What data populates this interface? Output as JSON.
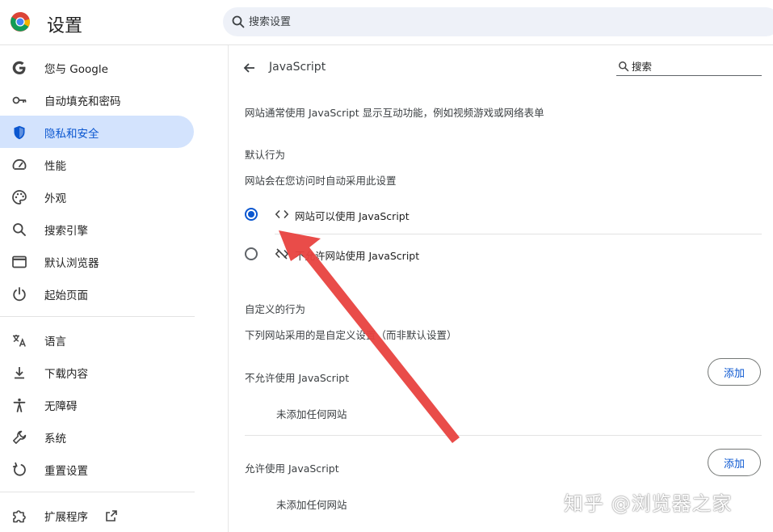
{
  "header": {
    "app_title": "设置",
    "search_placeholder": "搜索设置",
    "logo_icon": "chrome-logo-icon",
    "search_icon": "search-icon"
  },
  "sidebar": {
    "items": [
      {
        "label": "您与 Google",
        "icon": "google-g-icon",
        "active": false
      },
      {
        "label": "自动填充和密码",
        "icon": "key-icon",
        "active": false
      },
      {
        "label": "隐私和安全",
        "icon": "shield-icon",
        "active": true
      },
      {
        "label": "性能",
        "icon": "speedometer-icon",
        "active": false
      },
      {
        "label": "外观",
        "icon": "palette-icon",
        "active": false
      },
      {
        "label": "搜索引擎",
        "icon": "search-icon",
        "active": false
      },
      {
        "label": "默认浏览器",
        "icon": "browser-window-icon",
        "active": false
      },
      {
        "label": "起始页面",
        "icon": "power-icon",
        "active": false
      },
      {
        "label": "语言",
        "icon": "translate-icon",
        "active": false
      },
      {
        "label": "下载内容",
        "icon": "download-icon",
        "active": false
      },
      {
        "label": "无障碍",
        "icon": "accessibility-icon",
        "active": false
      },
      {
        "label": "系统",
        "icon": "wrench-icon",
        "active": false
      },
      {
        "label": "重置设置",
        "icon": "reset-icon",
        "active": false
      },
      {
        "label": "扩展程序",
        "icon": "puzzle-icon",
        "active": false
      }
    ],
    "external_link_icon": "external-link-icon"
  },
  "main": {
    "title": "JavaScript",
    "search_placeholder": "搜索",
    "description": "网站通常使用 JavaScript 显示互动功能，例如视频游戏或网络表单",
    "default_behavior": {
      "heading": "默认行为",
      "subtitle": "网站会在您访问时自动采用此设置",
      "options": [
        {
          "label": "网站可以使用 JavaScript",
          "icon": "code-brackets-icon",
          "selected": true
        },
        {
          "label": "不允许网站使用 JavaScript",
          "icon": "code-off-icon",
          "selected": false
        }
      ]
    },
    "custom_behavior": {
      "heading": "自定义的行为",
      "subtitle": "下列网站采用的是自定义设置（而非默认设置）",
      "lists": [
        {
          "title": "不允许使用 JavaScript",
          "add_label": "添加",
          "empty_text": "未添加任何网站"
        },
        {
          "title": "允许使用 JavaScript",
          "add_label": "添加",
          "empty_text": "未添加任何网站"
        }
      ]
    }
  },
  "watermark": "知乎 @浏览器之家",
  "colors": {
    "accent": "#0b57d0",
    "active_bg": "#d3e3fd",
    "search_bg": "#eef1f8",
    "annotation_arrow": "#e8423f"
  }
}
